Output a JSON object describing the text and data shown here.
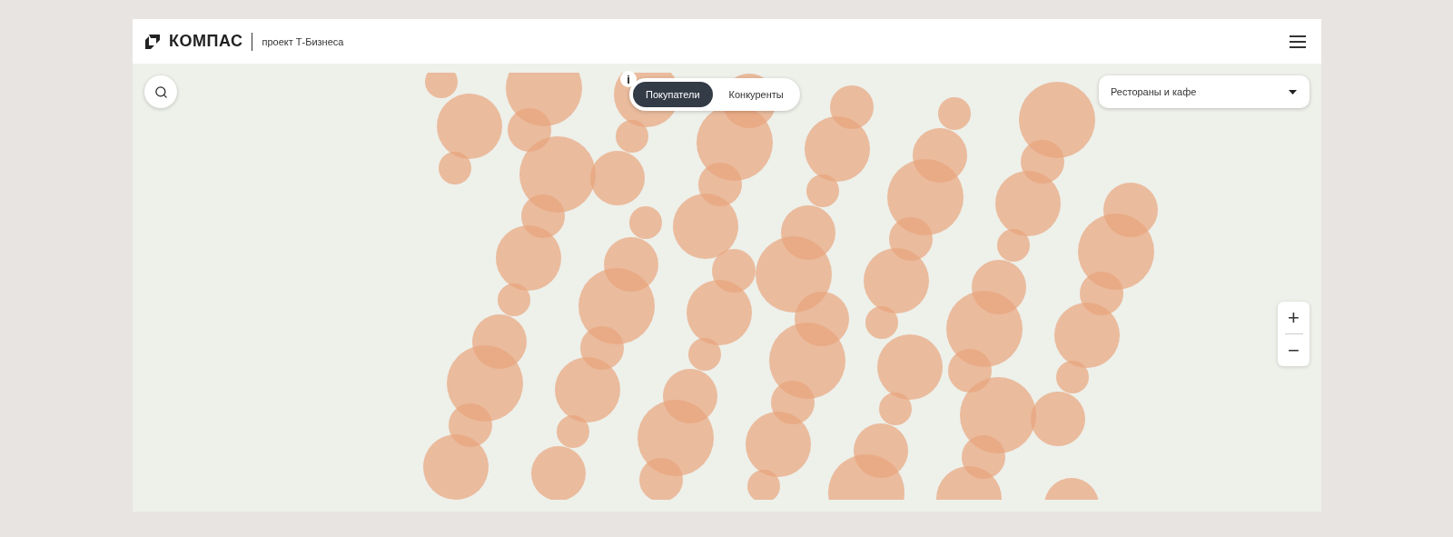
{
  "header": {
    "logo": "КОМПАС",
    "subtitle": "проект Т-Бизнеса"
  },
  "map": {
    "info": "i",
    "audience_tabs": [
      {
        "label": "Покупатели",
        "selected": true
      },
      {
        "label": "Конкуренты",
        "selected": false
      }
    ],
    "category_select": {
      "value": "Рестораны и кафе"
    },
    "zoom": {
      "in": "+",
      "out": "−"
    }
  }
}
